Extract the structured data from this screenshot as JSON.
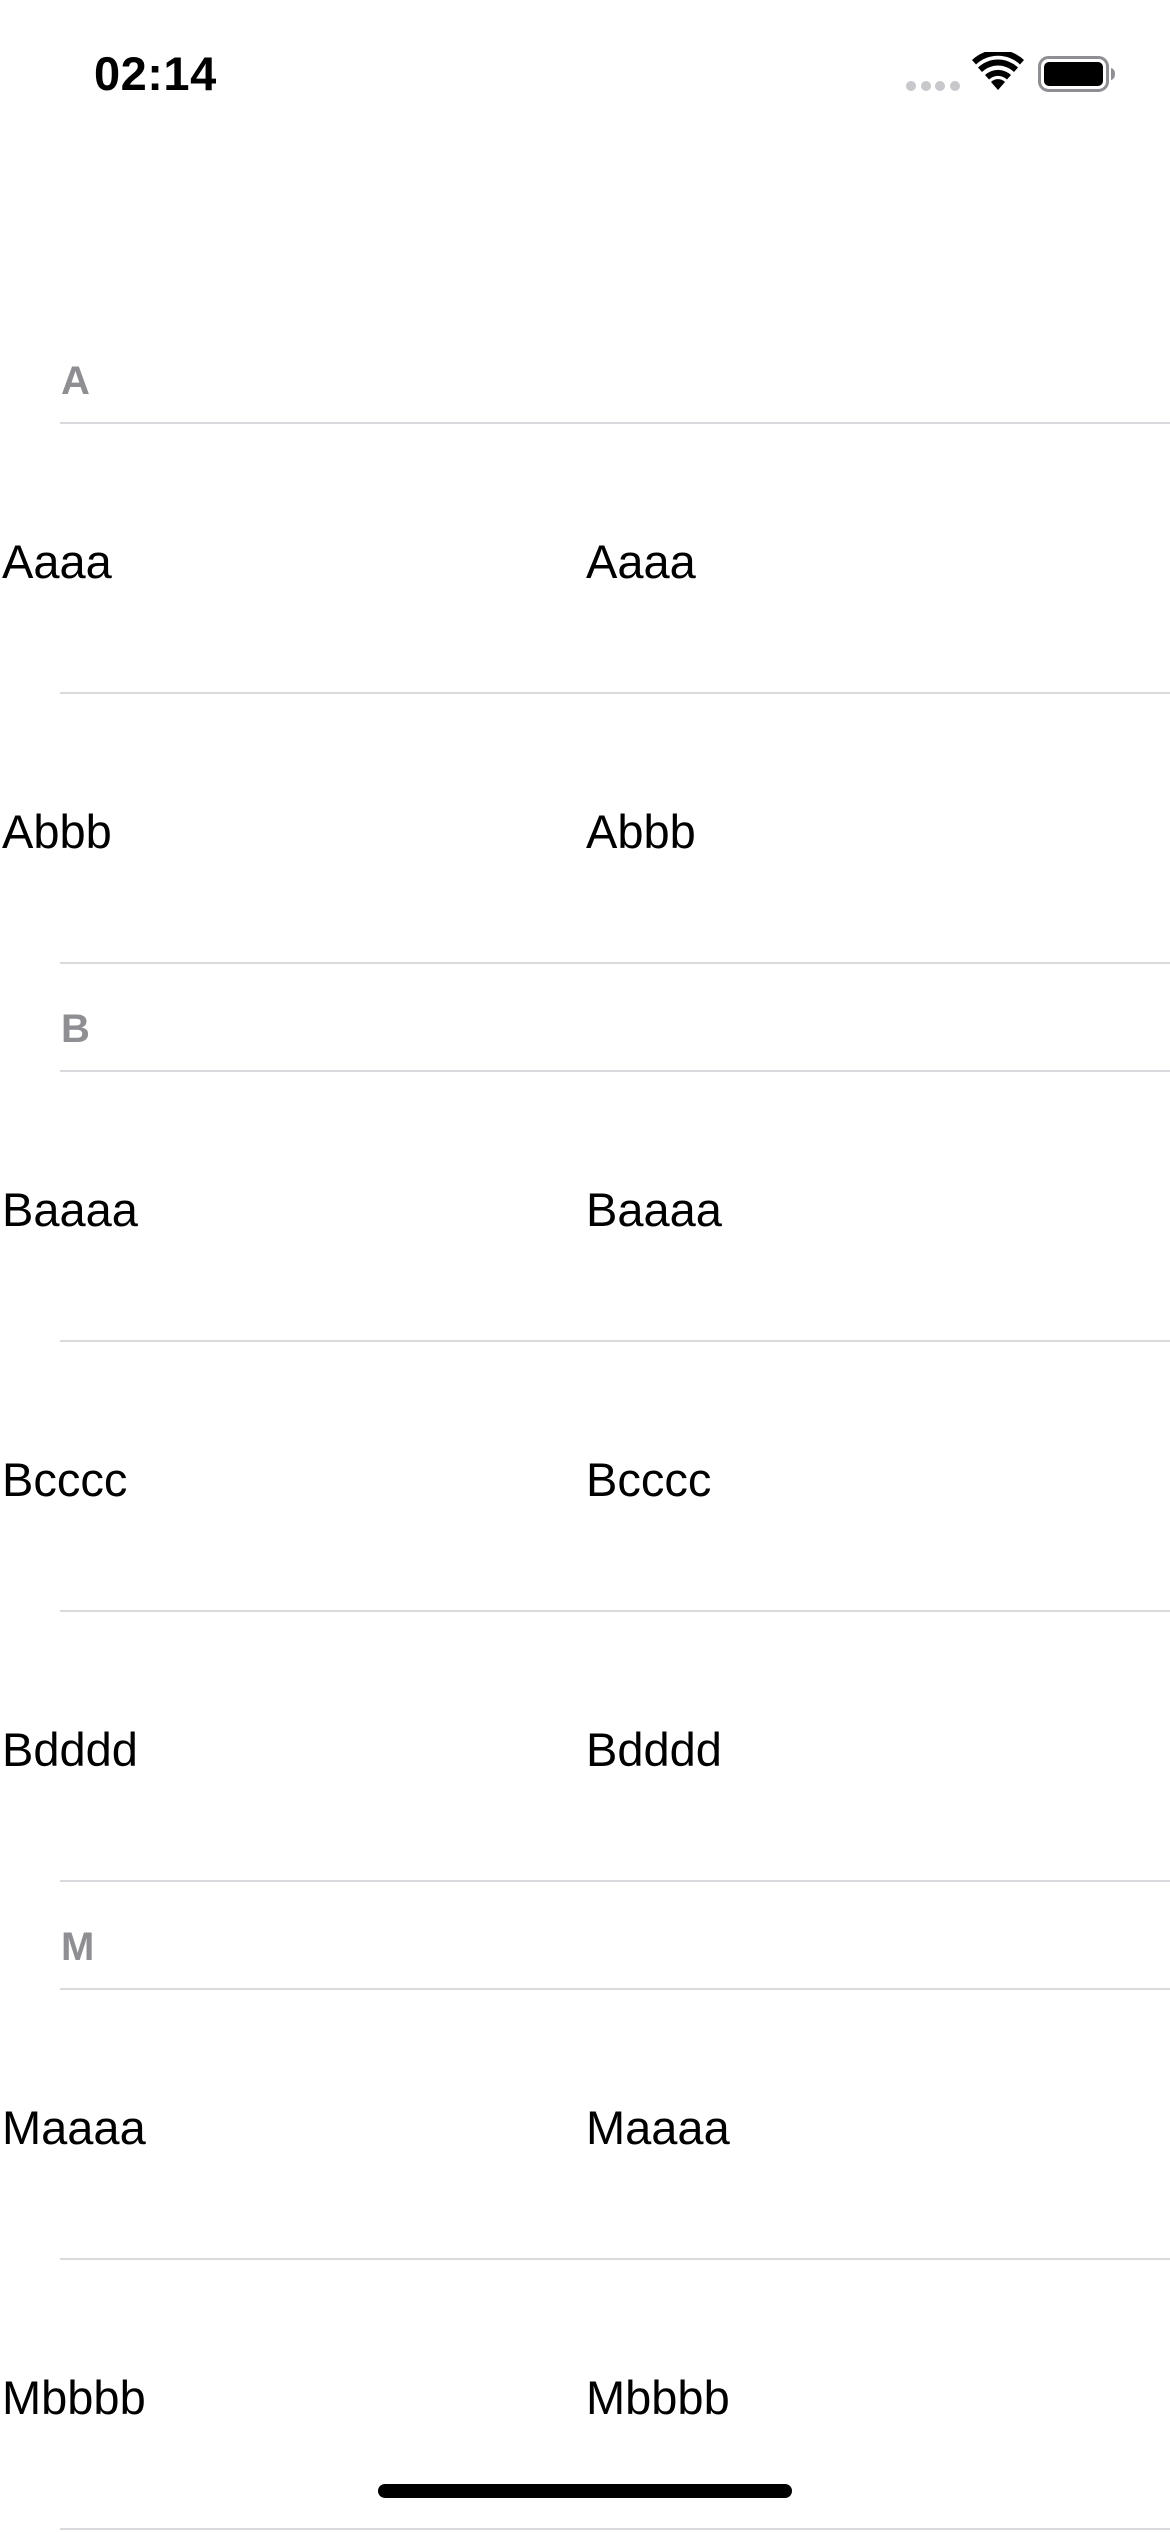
{
  "status_bar": {
    "time": "02:14",
    "icons": [
      "cellular-signal-icon",
      "wifi-icon",
      "battery-icon"
    ]
  },
  "sections": [
    {
      "letter": "A",
      "rows": [
        {
          "left": "Aaaa",
          "right": "Aaaa"
        },
        {
          "left": "Abbb",
          "right": "Abbb"
        }
      ]
    },
    {
      "letter": "B",
      "rows": [
        {
          "left": "Baaaa",
          "right": "Baaaa"
        },
        {
          "left": "Bcccc",
          "right": "Bcccc"
        },
        {
          "left": "Bdddd",
          "right": "Bdddd"
        }
      ]
    },
    {
      "letter": "M",
      "rows": [
        {
          "left": "Maaaa",
          "right": "Maaaa"
        },
        {
          "left": "Mbbbb",
          "right": "Mbbbb"
        }
      ]
    }
  ],
  "colors": {
    "section_header_text": "#8e8e93",
    "separator": "#d9d9de",
    "signal_dots": "#c7c7cc",
    "text": "#000000",
    "background": "#ffffff"
  }
}
